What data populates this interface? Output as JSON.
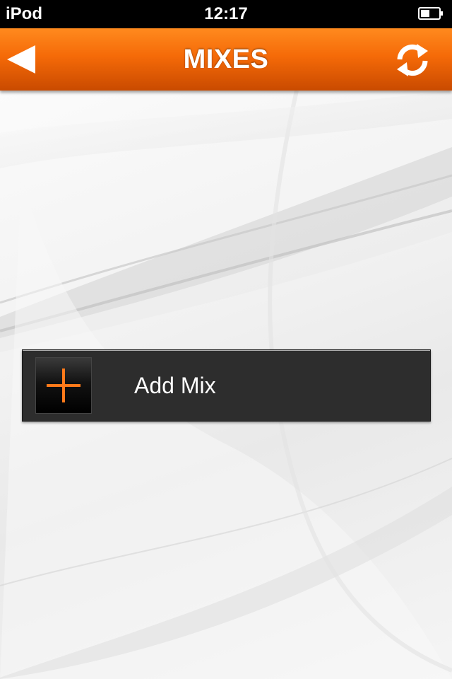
{
  "status_bar": {
    "carrier": "iPod",
    "time": "12:17",
    "battery_level": 0.5
  },
  "nav_bar": {
    "title": "MIXES",
    "back_icon": "back-arrow-icon",
    "refresh_icon": "refresh-icon"
  },
  "list": {
    "add_mix": {
      "label": "Add Mix",
      "icon": "plus-icon"
    }
  },
  "colors": {
    "nav_orange": "#f56a08",
    "accent_plus": "#ff7a1a",
    "row_background": "#2d2d2d",
    "text_light": "#ffffff"
  }
}
